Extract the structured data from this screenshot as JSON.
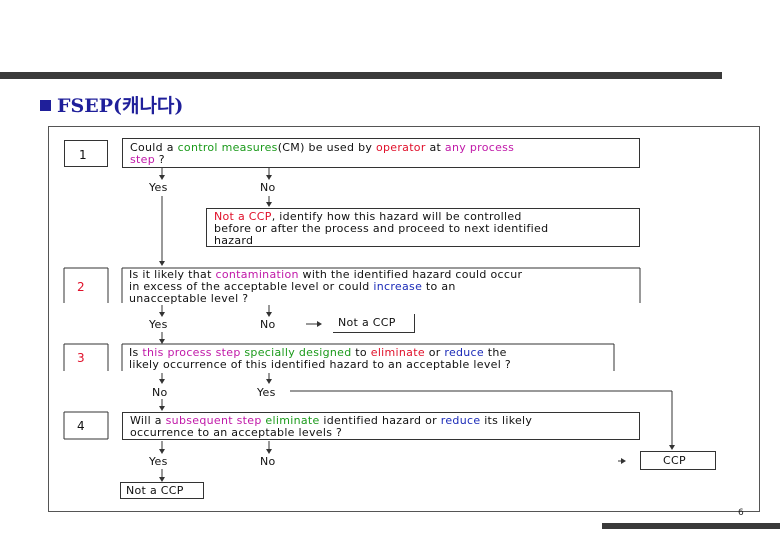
{
  "slide": {
    "title": "FSEP(캐나다)",
    "page_number": "6"
  },
  "steps": {
    "s1": {
      "number": "1",
      "q_a": "Could a ",
      "q_b": "control measures",
      "q_c": "(CM)",
      "q_d": " be used by ",
      "q_e": "operator",
      "q_f": " at ",
      "q_g": "any process",
      "q_h": "step",
      "q_i": " ?",
      "yes": "Yes",
      "no": "No"
    },
    "notccp1": {
      "a": "Not a CCP",
      "b": ", identify how this hazard will be controlled",
      "line2": "before or after the process and proceed to next identified",
      "line3": "hazard"
    },
    "s2": {
      "number": "2",
      "a": "Is it likely that ",
      "b": "contamination",
      "c": " with the identified hazard could occur",
      "line2a": "in excess of the acceptable level or could ",
      "line2b": "increase",
      "line2c": " to an",
      "line3": "unacceptable level ?",
      "yes": "Yes",
      "no": "No",
      "result": "Not a CCP"
    },
    "s3": {
      "number": "3",
      "a": "Is ",
      "b": "this process step",
      "c": " ",
      "d": "specially designed",
      "e": " to ",
      "f": "eliminate",
      "g": " or ",
      "h": "reduce",
      "i": " the",
      "line2": "likely occurrence of this identified hazard to an acceptable level ?",
      "no": "No",
      "yes": "Yes"
    },
    "s4": {
      "number": "4",
      "a": "Will a ",
      "b": "subsequent step",
      "c": " ",
      "d": "eliminate",
      "e": " identified hazard or ",
      "f": "reduce",
      "g": " its likely",
      "line2": "occurrence to an acceptable levels ?",
      "yes": "Yes",
      "no": "No",
      "result_ccp": "CCP",
      "result_not": "Not a CCP"
    }
  },
  "colors": {
    "title": "#1f1f9a",
    "green": "#1a9a1a",
    "red": "#e0102a",
    "magenta": "#c018a8",
    "blue": "#1a2ab8"
  }
}
